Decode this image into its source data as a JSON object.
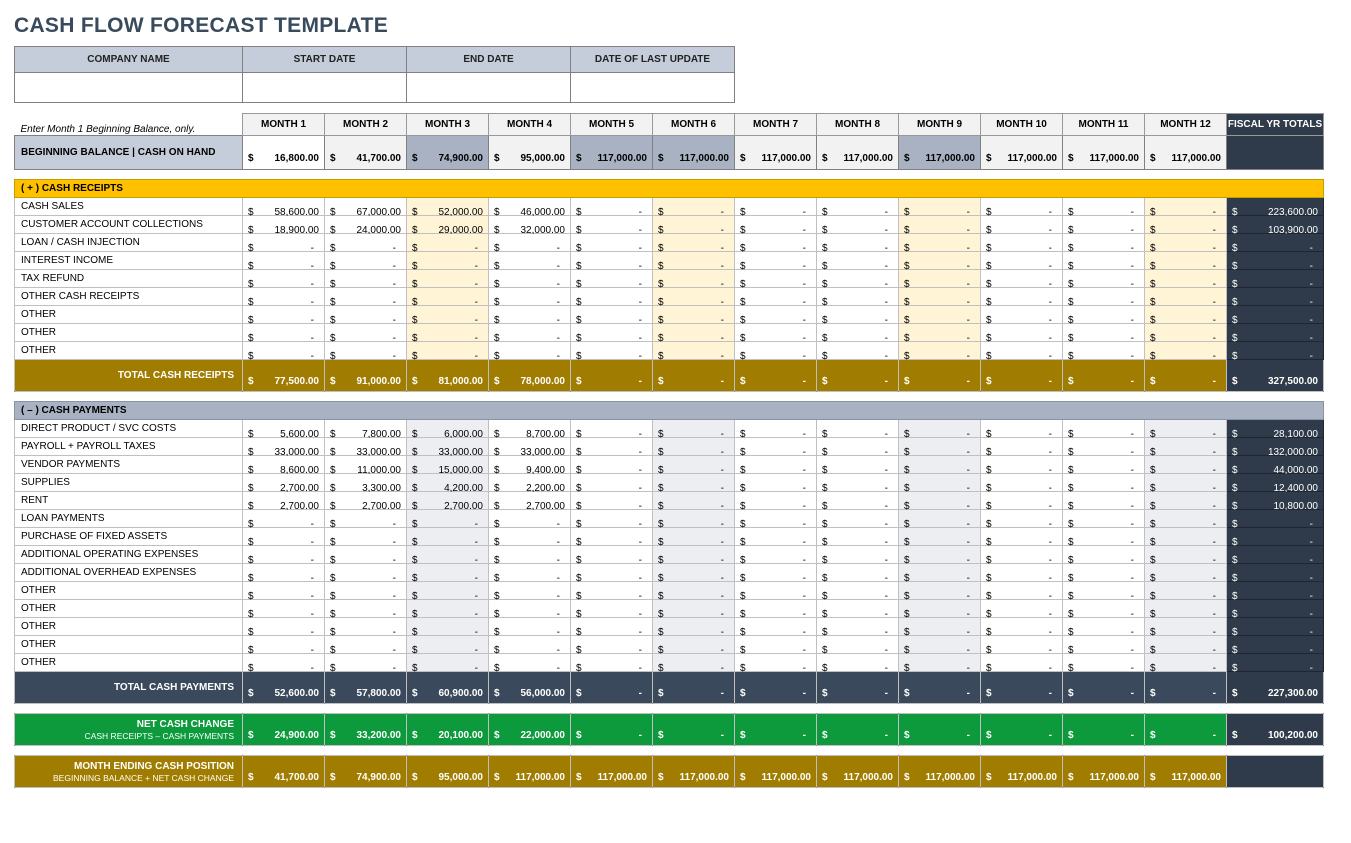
{
  "title": "CASH FLOW FORECAST TEMPLATE",
  "header": {
    "company": "COMPANY NAME",
    "start": "START DATE",
    "end": "END DATE",
    "update": "DATE OF LAST UPDATE"
  },
  "hint": "Enter Month 1 Beginning Balance, only.",
  "months": [
    "MONTH 1",
    "MONTH 2",
    "MONTH 3",
    "MONTH 4",
    "MONTH 5",
    "MONTH 6",
    "MONTH 7",
    "MONTH 8",
    "MONTH 9",
    "MONTH 10",
    "MONTH 11",
    "MONTH 12"
  ],
  "fiscal_label": "FISCAL YR TOTALS",
  "beginning": {
    "label": "BEGINNING BALANCE  |  CASH ON HAND",
    "values": [
      "16,800.00",
      "41,700.00",
      "74,900.00",
      "95,000.00",
      "117,000.00",
      "117,000.00",
      "117,000.00",
      "117,000.00",
      "117,000.00",
      "117,000.00",
      "117,000.00",
      "117,000.00"
    ],
    "shades": [
      "#ffffff",
      "#f2f2f2",
      "#a8b2c3",
      "#f2f2f2",
      "#a8b2c3",
      "#a8b2c3",
      "#f2f2f2",
      "#f2f2f2",
      "#a8b2c3",
      "#f2f2f2",
      "#f2f2f2",
      "#f2f2f2"
    ]
  },
  "receipts": {
    "section_label": "( + )   CASH RECEIPTS",
    "rows": [
      {
        "label": "CASH SALES",
        "cells": [
          "58,600.00",
          "67,000.00",
          "52,000.00",
          "46,000.00",
          "",
          "",
          "",
          "",
          "",
          "",
          "",
          ""
        ],
        "shades": [
          "#ffffff",
          "#ffffff",
          "#fff5d6",
          "#ffffff",
          "#ffffff",
          "#fff5d6",
          "#ffffff",
          "#ffffff",
          "#fff5d6",
          "#ffffff",
          "#ffffff",
          "#fff5d6"
        ],
        "total": "223,600.00"
      },
      {
        "label": "CUSTOMER ACCOUNT COLLECTIONS",
        "cells": [
          "18,900.00",
          "24,000.00",
          "29,000.00",
          "32,000.00",
          "",
          "",
          "",
          "",
          "",
          "",
          "",
          ""
        ],
        "shades": [
          "#ffffff",
          "#ffffff",
          "#fff5d6",
          "#ffffff",
          "#ffffff",
          "#fff5d6",
          "#ffffff",
          "#ffffff",
          "#fff5d6",
          "#ffffff",
          "#ffffff",
          "#fff5d6"
        ],
        "total": "103,900.00"
      },
      {
        "label": "LOAN / CASH INJECTION",
        "cells": [
          "",
          "",
          "",
          "",
          "",
          "",
          "",
          "",
          "",
          "",
          "",
          ""
        ],
        "shades": [
          "#ffffff",
          "#ffffff",
          "#fff5d6",
          "#ffffff",
          "#ffffff",
          "#fff5d6",
          "#ffffff",
          "#ffffff",
          "#fff5d6",
          "#ffffff",
          "#ffffff",
          "#fff5d6"
        ],
        "total": ""
      },
      {
        "label": "INTEREST INCOME",
        "cells": [
          "",
          "",
          "",
          "",
          "",
          "",
          "",
          "",
          "",
          "",
          "",
          ""
        ],
        "shades": [
          "#ffffff",
          "#ffffff",
          "#fff5d6",
          "#ffffff",
          "#ffffff",
          "#fff5d6",
          "#ffffff",
          "#ffffff",
          "#fff5d6",
          "#ffffff",
          "#ffffff",
          "#fff5d6"
        ],
        "total": ""
      },
      {
        "label": "TAX REFUND",
        "cells": [
          "",
          "",
          "",
          "",
          "",
          "",
          "",
          "",
          "",
          "",
          "",
          ""
        ],
        "shades": [
          "#ffffff",
          "#ffffff",
          "#fff5d6",
          "#ffffff",
          "#ffffff",
          "#fff5d6",
          "#ffffff",
          "#ffffff",
          "#fff5d6",
          "#ffffff",
          "#ffffff",
          "#fff5d6"
        ],
        "total": ""
      },
      {
        "label": "OTHER CASH RECEIPTS",
        "cells": [
          "",
          "",
          "",
          "",
          "",
          "",
          "",
          "",
          "",
          "",
          "",
          ""
        ],
        "shades": [
          "#ffffff",
          "#ffffff",
          "#fff5d6",
          "#ffffff",
          "#ffffff",
          "#fff5d6",
          "#ffffff",
          "#ffffff",
          "#fff5d6",
          "#ffffff",
          "#ffffff",
          "#fff5d6"
        ],
        "total": ""
      },
      {
        "label": "OTHER",
        "cells": [
          "",
          "",
          "",
          "",
          "",
          "",
          "",
          "",
          "",
          "",
          "",
          ""
        ],
        "shades": [
          "#ffffff",
          "#ffffff",
          "#fff5d6",
          "#ffffff",
          "#ffffff",
          "#fff5d6",
          "#ffffff",
          "#ffffff",
          "#fff5d6",
          "#ffffff",
          "#ffffff",
          "#fff5d6"
        ],
        "total": ""
      },
      {
        "label": "OTHER",
        "cells": [
          "",
          "",
          "",
          "",
          "",
          "",
          "",
          "",
          "",
          "",
          "",
          ""
        ],
        "shades": [
          "#ffffff",
          "#ffffff",
          "#fff5d6",
          "#ffffff",
          "#ffffff",
          "#fff5d6",
          "#ffffff",
          "#ffffff",
          "#fff5d6",
          "#ffffff",
          "#ffffff",
          "#fff5d6"
        ],
        "total": ""
      },
      {
        "label": "OTHER",
        "cells": [
          "",
          "",
          "",
          "",
          "",
          "",
          "",
          "",
          "",
          "",
          "",
          ""
        ],
        "shades": [
          "#ffffff",
          "#ffffff",
          "#fff5d6",
          "#ffffff",
          "#ffffff",
          "#fff5d6",
          "#ffffff",
          "#ffffff",
          "#fff5d6",
          "#ffffff",
          "#ffffff",
          "#fff5d6"
        ],
        "total": ""
      }
    ],
    "total_label": "TOTAL CASH RECEIPTS",
    "total_cells": [
      "77,500.00",
      "91,000.00",
      "81,000.00",
      "78,000.00",
      "",
      "",
      "",
      "",
      "",
      "",
      "",
      ""
    ],
    "total_fiscal": "327,500.00"
  },
  "payments": {
    "section_label": "( – )   CASH PAYMENTS",
    "rows": [
      {
        "label": "DIRECT PRODUCT / SVC COSTS",
        "cells": [
          "5,600.00",
          "7,800.00",
          "6,000.00",
          "8,700.00",
          "",
          "",
          "",
          "",
          "",
          "",
          "",
          ""
        ],
        "shades": [
          "#ffffff",
          "#ffffff",
          "#eceef2",
          "#ffffff",
          "#ffffff",
          "#eceef2",
          "#ffffff",
          "#ffffff",
          "#eceef2",
          "#ffffff",
          "#ffffff",
          "#eceef2"
        ],
        "total": "28,100.00"
      },
      {
        "label": "PAYROLL + PAYROLL TAXES",
        "cells": [
          "33,000.00",
          "33,000.00",
          "33,000.00",
          "33,000.00",
          "",
          "",
          "",
          "",
          "",
          "",
          "",
          ""
        ],
        "shades": [
          "#ffffff",
          "#ffffff",
          "#eceef2",
          "#ffffff",
          "#ffffff",
          "#eceef2",
          "#ffffff",
          "#ffffff",
          "#eceef2",
          "#ffffff",
          "#ffffff",
          "#eceef2"
        ],
        "total": "132,000.00"
      },
      {
        "label": "VENDOR PAYMENTS",
        "cells": [
          "8,600.00",
          "11,000.00",
          "15,000.00",
          "9,400.00",
          "",
          "",
          "",
          "",
          "",
          "",
          "",
          ""
        ],
        "shades": [
          "#ffffff",
          "#ffffff",
          "#eceef2",
          "#ffffff",
          "#ffffff",
          "#eceef2",
          "#ffffff",
          "#ffffff",
          "#eceef2",
          "#ffffff",
          "#ffffff",
          "#eceef2"
        ],
        "total": "44,000.00"
      },
      {
        "label": "SUPPLIES",
        "cells": [
          "2,700.00",
          "3,300.00",
          "4,200.00",
          "2,200.00",
          "",
          "",
          "",
          "",
          "",
          "",
          "",
          ""
        ],
        "shades": [
          "#ffffff",
          "#ffffff",
          "#eceef2",
          "#ffffff",
          "#ffffff",
          "#eceef2",
          "#ffffff",
          "#ffffff",
          "#eceef2",
          "#ffffff",
          "#ffffff",
          "#eceef2"
        ],
        "total": "12,400.00"
      },
      {
        "label": "RENT",
        "cells": [
          "2,700.00",
          "2,700.00",
          "2,700.00",
          "2,700.00",
          "",
          "",
          "",
          "",
          "",
          "",
          "",
          ""
        ],
        "shades": [
          "#ffffff",
          "#ffffff",
          "#eceef2",
          "#ffffff",
          "#ffffff",
          "#eceef2",
          "#ffffff",
          "#ffffff",
          "#eceef2",
          "#ffffff",
          "#ffffff",
          "#eceef2"
        ],
        "total": "10,800.00"
      },
      {
        "label": "LOAN PAYMENTS",
        "cells": [
          "",
          "",
          "",
          "",
          "",
          "",
          "",
          "",
          "",
          "",
          "",
          ""
        ],
        "shades": [
          "#ffffff",
          "#ffffff",
          "#eceef2",
          "#ffffff",
          "#ffffff",
          "#eceef2",
          "#ffffff",
          "#ffffff",
          "#eceef2",
          "#ffffff",
          "#ffffff",
          "#eceef2"
        ],
        "total": ""
      },
      {
        "label": "PURCHASE OF FIXED ASSETS",
        "cells": [
          "",
          "",
          "",
          "",
          "",
          "",
          "",
          "",
          "",
          "",
          "",
          ""
        ],
        "shades": [
          "#ffffff",
          "#ffffff",
          "#eceef2",
          "#ffffff",
          "#ffffff",
          "#eceef2",
          "#ffffff",
          "#ffffff",
          "#eceef2",
          "#ffffff",
          "#ffffff",
          "#eceef2"
        ],
        "total": ""
      },
      {
        "label": "ADDITIONAL OPERATING EXPENSES",
        "cells": [
          "",
          "",
          "",
          "",
          "",
          "",
          "",
          "",
          "",
          "",
          "",
          ""
        ],
        "shades": [
          "#ffffff",
          "#ffffff",
          "#eceef2",
          "#ffffff",
          "#ffffff",
          "#eceef2",
          "#ffffff",
          "#ffffff",
          "#eceef2",
          "#ffffff",
          "#ffffff",
          "#eceef2"
        ],
        "total": ""
      },
      {
        "label": "ADDITIONAL OVERHEAD EXPENSES",
        "cells": [
          "",
          "",
          "",
          "",
          "",
          "",
          "",
          "",
          "",
          "",
          "",
          ""
        ],
        "shades": [
          "#ffffff",
          "#ffffff",
          "#eceef2",
          "#ffffff",
          "#ffffff",
          "#eceef2",
          "#ffffff",
          "#ffffff",
          "#eceef2",
          "#ffffff",
          "#ffffff",
          "#eceef2"
        ],
        "total": ""
      },
      {
        "label": "OTHER",
        "cells": [
          "",
          "",
          "",
          "",
          "",
          "",
          "",
          "",
          "",
          "",
          "",
          ""
        ],
        "shades": [
          "#ffffff",
          "#ffffff",
          "#eceef2",
          "#ffffff",
          "#ffffff",
          "#eceef2",
          "#ffffff",
          "#ffffff",
          "#eceef2",
          "#ffffff",
          "#ffffff",
          "#eceef2"
        ],
        "total": ""
      },
      {
        "label": "OTHER",
        "cells": [
          "",
          "",
          "",
          "",
          "",
          "",
          "",
          "",
          "",
          "",
          "",
          ""
        ],
        "shades": [
          "#ffffff",
          "#ffffff",
          "#eceef2",
          "#ffffff",
          "#ffffff",
          "#eceef2",
          "#ffffff",
          "#ffffff",
          "#eceef2",
          "#ffffff",
          "#ffffff",
          "#eceef2"
        ],
        "total": ""
      },
      {
        "label": "OTHER",
        "cells": [
          "",
          "",
          "",
          "",
          "",
          "",
          "",
          "",
          "",
          "",
          "",
          ""
        ],
        "shades": [
          "#ffffff",
          "#ffffff",
          "#eceef2",
          "#ffffff",
          "#ffffff",
          "#eceef2",
          "#ffffff",
          "#ffffff",
          "#eceef2",
          "#ffffff",
          "#ffffff",
          "#eceef2"
        ],
        "total": ""
      },
      {
        "label": "OTHER",
        "cells": [
          "",
          "",
          "",
          "",
          "",
          "",
          "",
          "",
          "",
          "",
          "",
          ""
        ],
        "shades": [
          "#ffffff",
          "#ffffff",
          "#eceef2",
          "#ffffff",
          "#ffffff",
          "#eceef2",
          "#ffffff",
          "#ffffff",
          "#eceef2",
          "#ffffff",
          "#ffffff",
          "#eceef2"
        ],
        "total": ""
      },
      {
        "label": "OTHER",
        "cells": [
          "",
          "",
          "",
          "",
          "",
          "",
          "",
          "",
          "",
          "",
          "",
          ""
        ],
        "shades": [
          "#ffffff",
          "#ffffff",
          "#eceef2",
          "#ffffff",
          "#ffffff",
          "#eceef2",
          "#ffffff",
          "#ffffff",
          "#eceef2",
          "#ffffff",
          "#ffffff",
          "#eceef2"
        ],
        "total": ""
      }
    ],
    "total_label": "TOTAL CASH PAYMENTS",
    "total_cells": [
      "52,600.00",
      "57,800.00",
      "60,900.00",
      "56,000.00",
      "",
      "",
      "",
      "",
      "",
      "",
      "",
      ""
    ],
    "total_fiscal": "227,300.00"
  },
  "netchange": {
    "label": "NET CASH CHANGE",
    "sub": "CASH RECEIPTS – CASH PAYMENTS",
    "cells": [
      "24,900.00",
      "33,200.00",
      "20,100.00",
      "22,000.00",
      "",
      "",
      "",
      "",
      "",
      "",
      "",
      ""
    ],
    "fiscal": "100,200.00"
  },
  "ending": {
    "label": "MONTH ENDING CASH POSITION",
    "sub": "BEGINNING BALANCE + NET CASH CHANGE",
    "cells": [
      "41,700.00",
      "74,900.00",
      "95,000.00",
      "117,000.00",
      "117,000.00",
      "117,000.00",
      "117,000.00",
      "117,000.00",
      "117,000.00",
      "117,000.00",
      "117,000.00",
      "117,000.00"
    ],
    "fiscal": ""
  }
}
